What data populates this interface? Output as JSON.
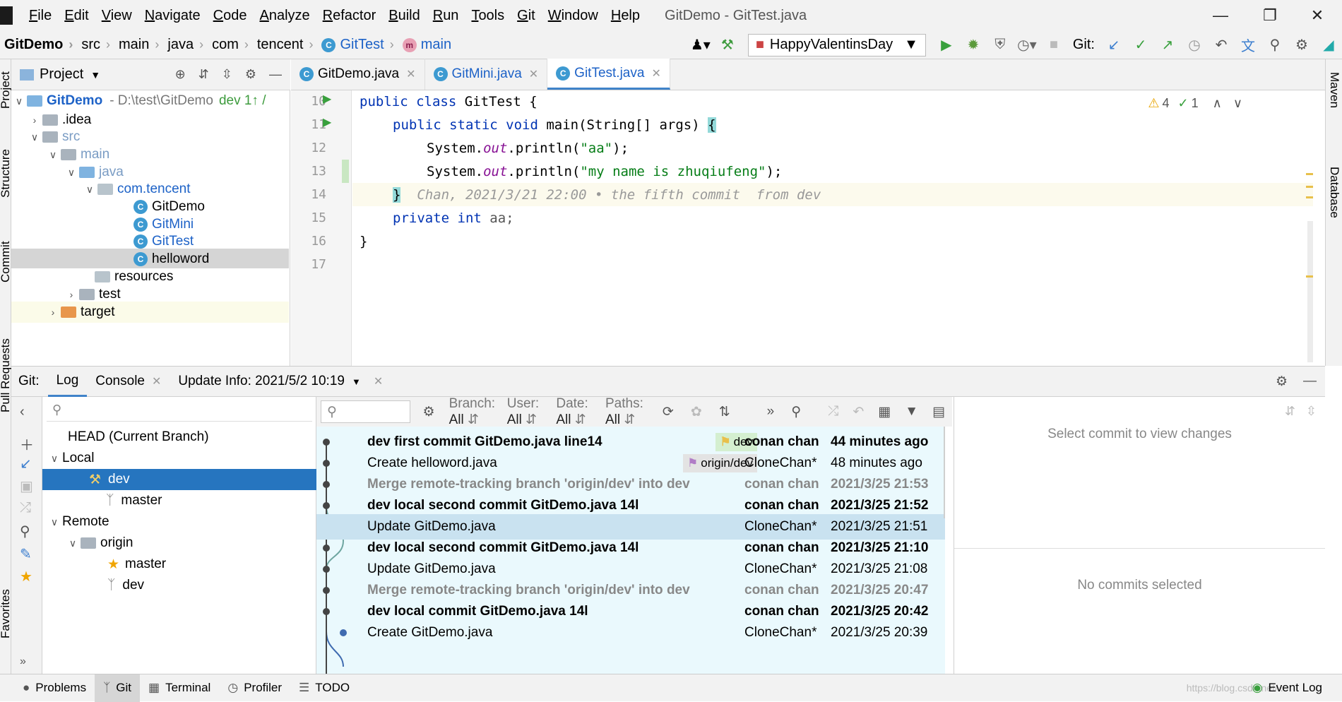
{
  "menubar": {
    "items": [
      "File",
      "Edit",
      "View",
      "Navigate",
      "Code",
      "Analyze",
      "Refactor",
      "Build",
      "Run",
      "Tools",
      "Git",
      "Window",
      "Help"
    ],
    "window_title": "GitDemo - GitTest.java"
  },
  "navbar": {
    "crumbs": [
      "GitDemo",
      "src",
      "main",
      "java",
      "com",
      "tencent",
      "GitTest",
      "main"
    ],
    "run_config": "HappyValentinsDay",
    "git_label": "Git:"
  },
  "side_tabs": {
    "left": [
      "Project",
      "Structure",
      "Commit",
      "Pull Requests",
      "Favorites"
    ],
    "right": [
      "Maven",
      "Database"
    ]
  },
  "project": {
    "title": "Project",
    "root_name": "GitDemo",
    "root_path": "- D:\\test\\GitDemo",
    "root_branch": "dev 1↑ /",
    "nodes": [
      ".idea",
      "src",
      "main",
      "java",
      "com.tencent",
      "GitDemo",
      "GitMini",
      "GitTest",
      "helloword",
      "resources",
      "test",
      "target"
    ]
  },
  "editor": {
    "tabs": [
      "GitDemo.java",
      "GitMini.java",
      "GitTest.java"
    ],
    "line_numbers": [
      "10",
      "11",
      "12",
      "13",
      "14",
      "15",
      "16",
      "17"
    ],
    "inspection_warnings": "4",
    "inspection_ok": "1",
    "code": {
      "l10_kw": "public class ",
      "l10_name": "GitTest {",
      "l11_kw": "public static void ",
      "l11_rest": "main(String[] args) ",
      "l11_brace": "{",
      "l12_a": "System.",
      "l12_out": "out",
      "l12_b": ".println(",
      "l12_str": "\"aa\"",
      "l12_c": ");",
      "l13_a": "System.",
      "l13_out": "out",
      "l13_b": ".println(",
      "l13_str": "\"my name is zhuqiufeng\"",
      "l13_c": ");",
      "l14_brace": "}",
      "l14_hint": "Chan, 2021/3/21 22:00 • the fifth commit  from dev",
      "l15_kw": "private int ",
      "l15_rest": "aa;",
      "l16": "}"
    }
  },
  "git": {
    "tabs": [
      "Git:",
      "Log",
      "Console",
      "Update Info: 2021/5/2 10:19"
    ],
    "branches": {
      "head": "HEAD (Current Branch)",
      "local": "Local",
      "local_items": [
        "dev",
        "master"
      ],
      "remote": "Remote",
      "origin": "origin",
      "origin_items": [
        "master",
        "dev"
      ]
    },
    "filters": {
      "branch": "Branch:",
      "branch_val": "All",
      "user": "User:",
      "user_val": "All",
      "date": "Date:",
      "date_val": "All",
      "paths": "Paths:",
      "paths_val": "All"
    },
    "log": [
      {
        "msg": "dev first   commit GitDemo.java line14",
        "tag": "dev",
        "author": "conan chan",
        "date": "44 minutes ago"
      },
      {
        "msg": "Create helloword.java",
        "tag": "origin/dev",
        "author": "CloneChan*",
        "date": "48 minutes ago"
      },
      {
        "msg": "Merge remote-tracking branch 'origin/dev' into dev",
        "author": "conan chan",
        "date": "2021/3/25 21:53"
      },
      {
        "msg": "dev local second  commit GitDemo.java 14l",
        "author": "conan chan",
        "date": "2021/3/25 21:52"
      },
      {
        "msg": "Update GitDemo.java",
        "author": "CloneChan*",
        "date": "2021/3/25 21:51"
      },
      {
        "msg": "dev local second  commit GitDemo.java 14l",
        "author": "conan chan",
        "date": "2021/3/25 21:10"
      },
      {
        "msg": "Update GitDemo.java",
        "author": "CloneChan*",
        "date": "2021/3/25 21:08"
      },
      {
        "msg": "Merge remote-tracking branch 'origin/dev' into dev",
        "author": "conan chan",
        "date": "2021/3/25 20:47"
      },
      {
        "msg": "dev local commit GitDemo.java 14l",
        "author": "conan chan",
        "date": "2021/3/25 20:42"
      },
      {
        "msg": "Create GitDemo.java",
        "author": "CloneChan*",
        "date": "2021/3/25 20:39"
      }
    ],
    "details_hint": "Select commit to view changes",
    "details_empty": "No commits selected"
  },
  "statusbar": {
    "items": [
      "Problems",
      "Git",
      "Terminal",
      "Profiler",
      "TODO"
    ],
    "event_log": "Event Log",
    "watermark": "https://blog.csdn.net/..."
  },
  "colors": {
    "accent": "#4083c9",
    "selection": "#2675bf",
    "log_bg": "#eaf9fd"
  }
}
